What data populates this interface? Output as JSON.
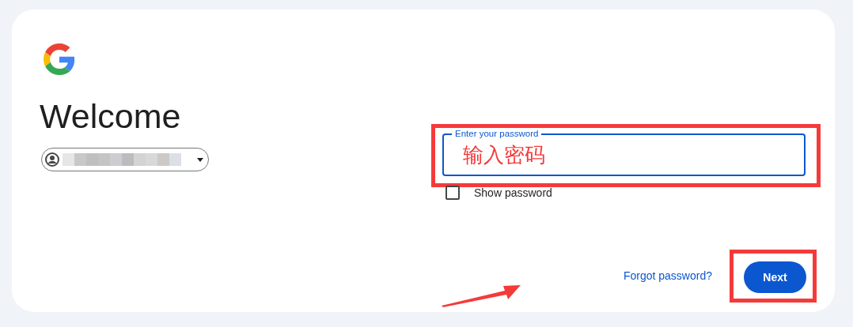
{
  "heading": "Welcome",
  "password_field": {
    "label": "Enter your password",
    "annotation": "输入密码"
  },
  "show_password": {
    "label": "Show password",
    "checked": false
  },
  "forgot_link": "Forgot password?",
  "next_button": "Next"
}
